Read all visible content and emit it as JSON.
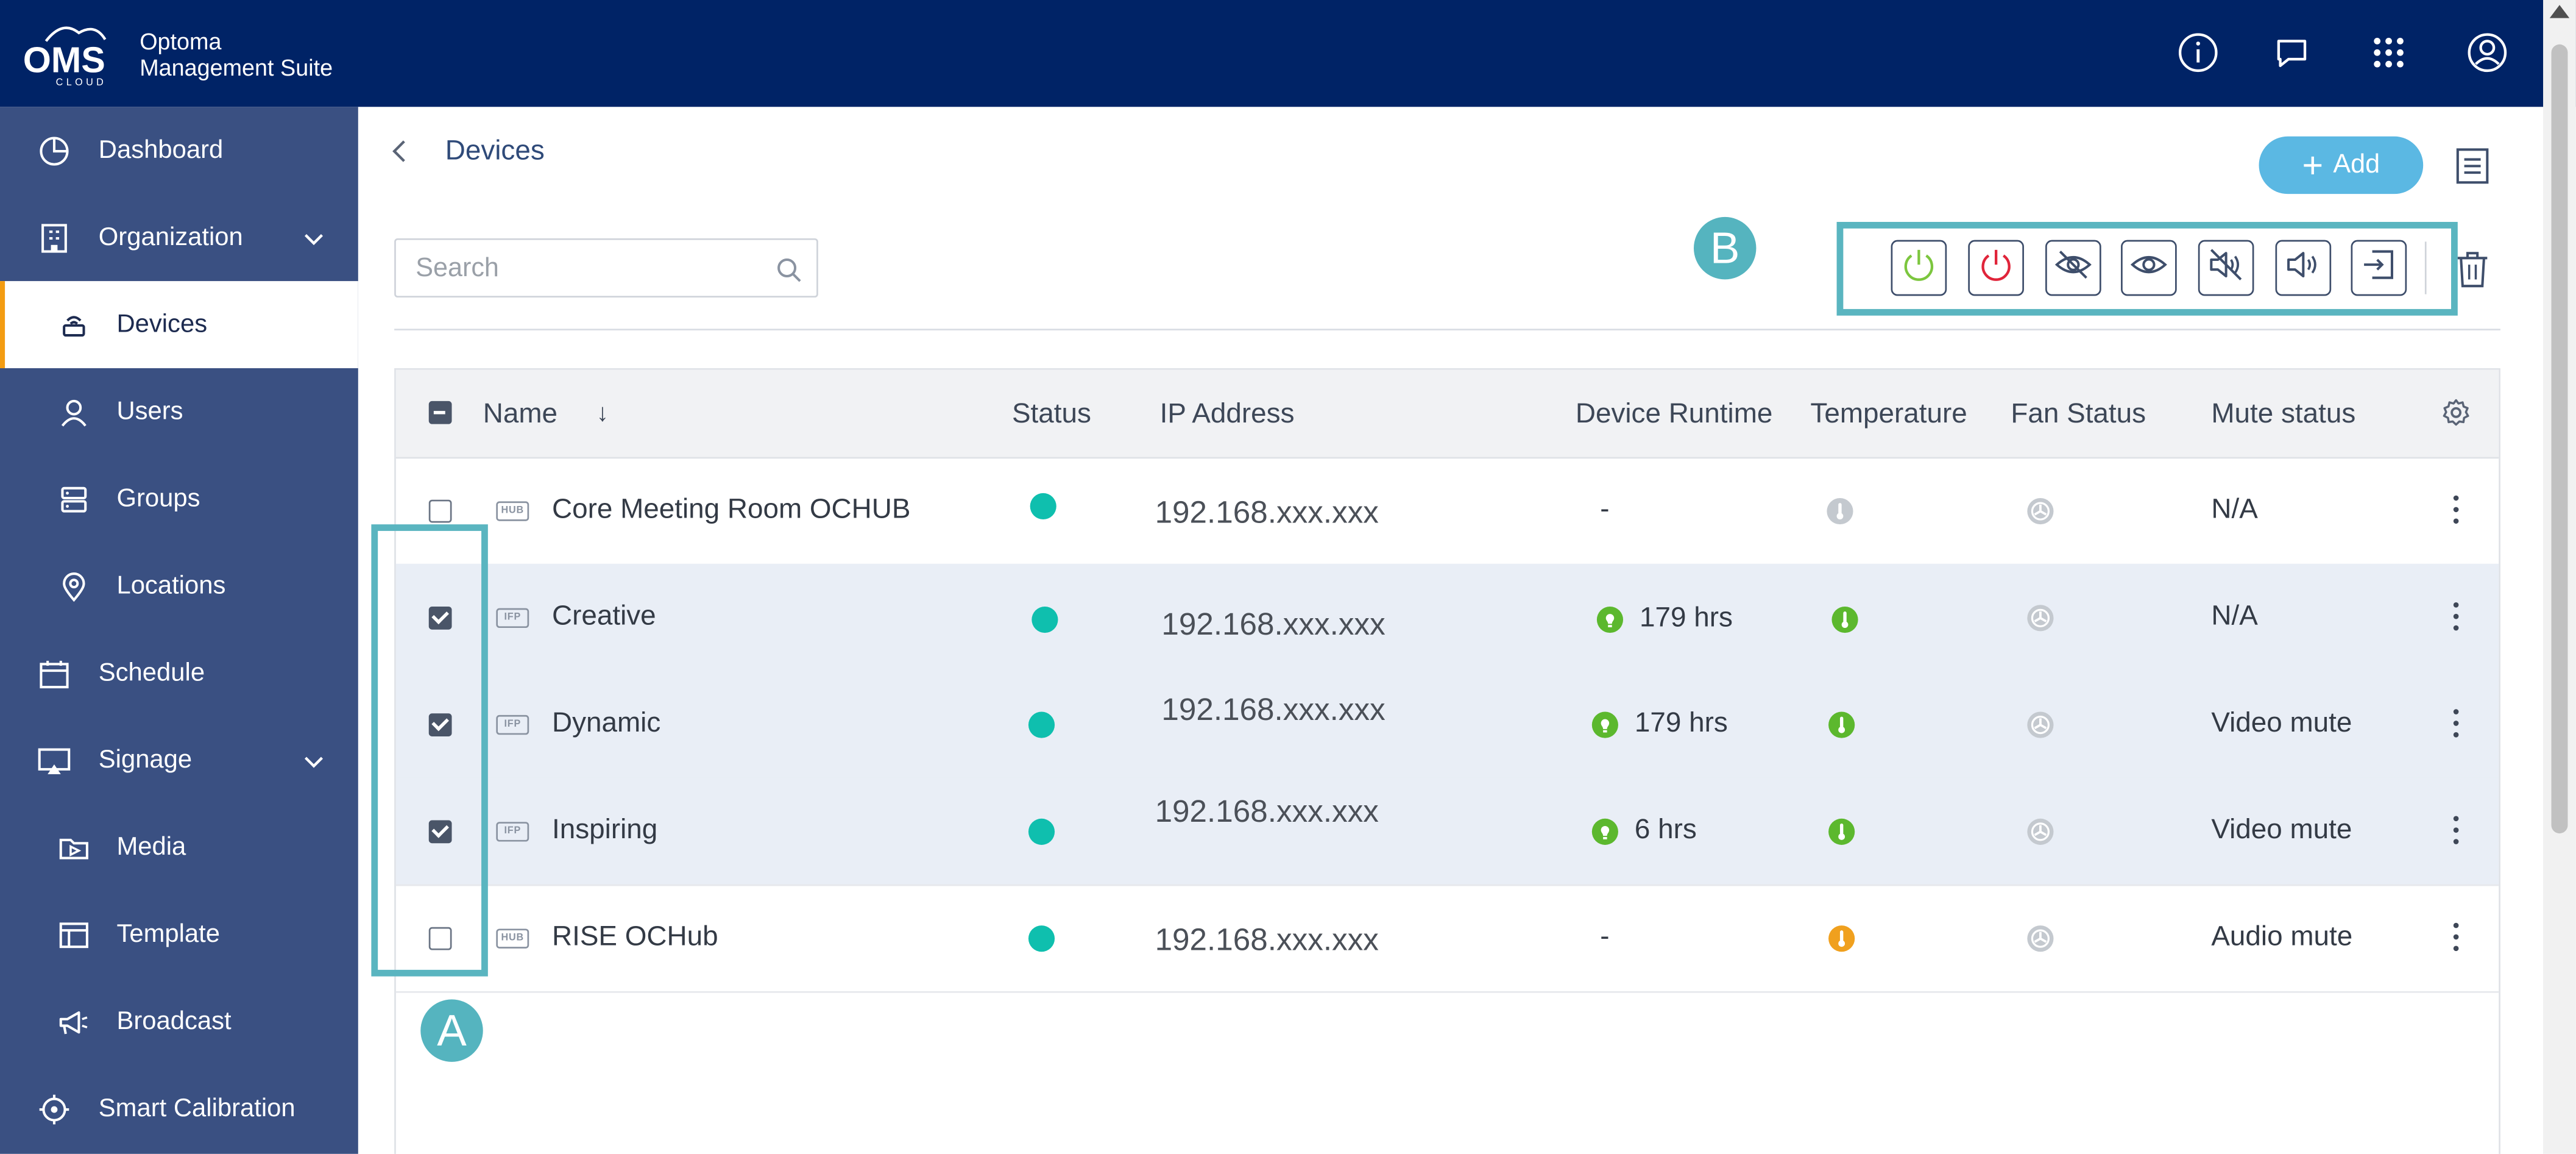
{
  "app": {
    "logo_text": "OMS",
    "logo_subtext": "CLOUD",
    "brand_line1": "Optoma",
    "brand_line2": "Management Suite"
  },
  "topbar_icons": [
    "info-icon",
    "chat-icon",
    "apps-grid-icon",
    "user-account-icon"
  ],
  "sidebar": {
    "items": [
      {
        "label": "Dashboard",
        "icon": "dashboard-icon"
      },
      {
        "label": "Organization",
        "icon": "building-icon"
      },
      {
        "label": "Devices",
        "icon": "device-icon"
      },
      {
        "label": "Users",
        "icon": "user-icon"
      },
      {
        "label": "Groups",
        "icon": "groups-icon"
      },
      {
        "label": "Locations",
        "icon": "location-pin-icon"
      },
      {
        "label": "Schedule",
        "icon": "calendar-icon"
      },
      {
        "label": "Signage",
        "icon": "signage-icon"
      },
      {
        "label": "Media",
        "icon": "media-folder-icon"
      },
      {
        "label": "Template",
        "icon": "template-icon"
      },
      {
        "label": "Broadcast",
        "icon": "megaphone-icon"
      },
      {
        "label": "Smart Calibration",
        "icon": "crosshair-icon"
      }
    ]
  },
  "page": {
    "title": "Devices",
    "add_label": "Add",
    "search_placeholder": "Search"
  },
  "callouts": {
    "a": "A",
    "b": "B"
  },
  "actions": [
    "power-on-icon",
    "power-off-icon",
    "video-mute-on-icon",
    "video-mute-off-icon",
    "audio-mute-on-icon",
    "audio-mute-off-icon",
    "input-source-icon"
  ],
  "table": {
    "headers": {
      "name": "Name",
      "sort": "↓",
      "status": "Status",
      "ip": "IP Address",
      "runtime": "Device Runtime",
      "temperature": "Temperature",
      "fan": "Fan Status",
      "mute": "Mute status"
    },
    "rows": [
      {
        "type": "HUB",
        "name": "Core Meeting Room OCHUB",
        "ip": "192.168.xxx.xxx",
        "runtime": "-",
        "mute": "N/A",
        "checked": false,
        "temp_color": "#c4c9cf"
      },
      {
        "type": "IFP",
        "name": "Creative",
        "ip": "192.168.xxx.xxx",
        "runtime": "179 hrs",
        "mute": "N/A",
        "checked": true,
        "temp_color": "#5cb82e"
      },
      {
        "type": "IFP",
        "name": "Dynamic",
        "ip": "192.168.xxx.xxx",
        "runtime": "179 hrs",
        "mute": "Video mute",
        "checked": true,
        "temp_color": "#5cb82e"
      },
      {
        "type": "IFP",
        "name": "Inspiring",
        "ip": "192.168.xxx.xxx",
        "runtime": "6 hrs",
        "mute": "Video mute",
        "checked": true,
        "temp_color": "#5cb82e"
      },
      {
        "type": "HUB",
        "name": "RISE OCHub",
        "ip": "192.168.xxx.xxx",
        "runtime": "-",
        "mute": "Audio mute",
        "checked": false,
        "temp_color": "#f0a01e"
      }
    ]
  },
  "colors": {
    "topbar": "#002366",
    "sidebar": "#3a5082",
    "accent": "#5bb8e3",
    "callout": "#55b4bf",
    "status_online": "#0fbfae"
  }
}
